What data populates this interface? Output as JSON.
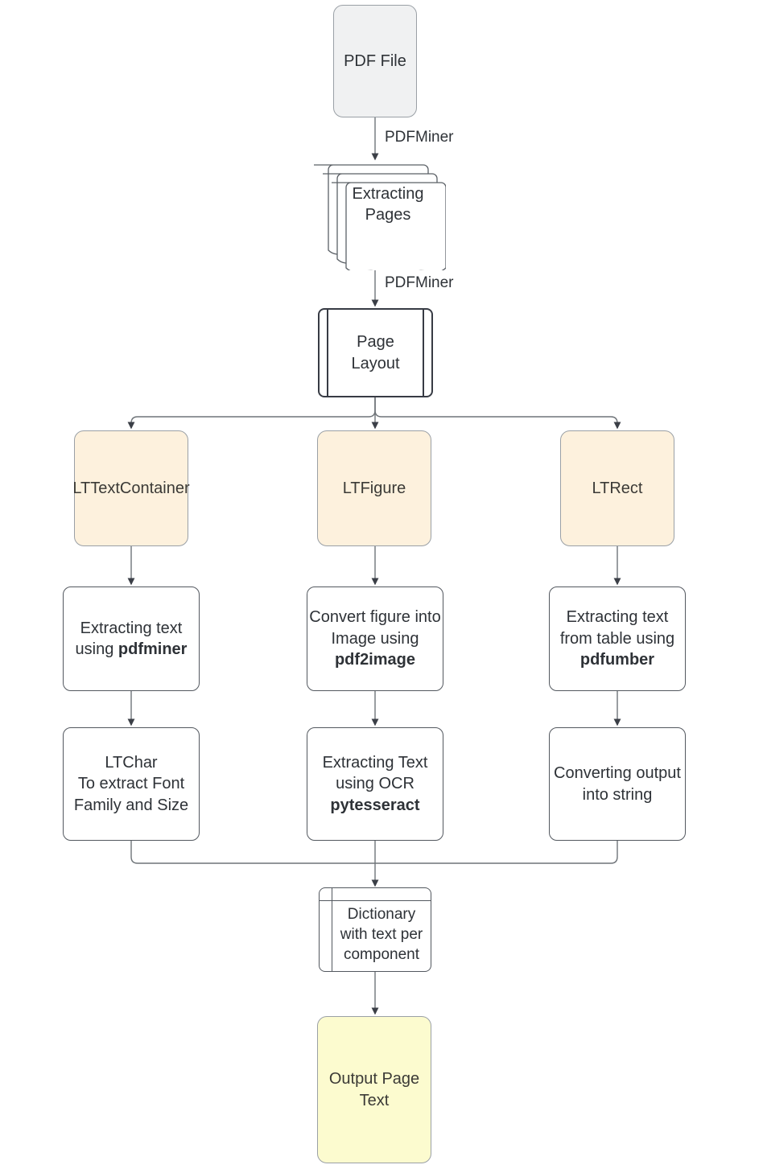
{
  "diagram": {
    "title": "PDF text extraction pipeline flowchart",
    "colors": {
      "cream_fill": "#fdf1dd",
      "yellow_fill": "#fcfbcf",
      "grey_fill": "#f0f1f2",
      "white_fill": "#ffffff",
      "dark_border": "#373b44",
      "grey_border": "#9aa0a6",
      "text": "#2e3237"
    }
  },
  "nodes": {
    "pdf_file": {
      "label": "PDF File",
      "shape": "rounded-rectangle"
    },
    "extracting_pages": {
      "label": "Extracting\nPages",
      "shape": "multi-document"
    },
    "page_layout": {
      "label": "Page\nLayout",
      "shape": "predefined-process"
    },
    "lttextcontainer": {
      "label": "LTTextContainer",
      "shape": "rounded-rectangle"
    },
    "ltfigure": {
      "label": "LTFigure",
      "shape": "rounded-rectangle"
    },
    "ltrect": {
      "label": "LTRect",
      "shape": "rounded-rectangle"
    },
    "extract_text_pdfminer": {
      "line1": "Extracting text",
      "line2_prefix": "using ",
      "line2_bold": "pdfminer"
    },
    "convert_figure": {
      "line1": "Convert figure into",
      "line2": "Image using",
      "line3_bold": "pdf2image"
    },
    "extract_table_pdfumber": {
      "line1": "Extracting text",
      "line2": "from table using",
      "line3_bold": "pdfumber"
    },
    "ltchar": {
      "label": "LTChar\nTo extract Font\nFamily and Size"
    },
    "ocr_pytesseract": {
      "line1": "Extracting Text",
      "line2": "using OCR",
      "line3_bold": "pytesseract"
    },
    "converting_output": {
      "label": "Converting output\ninto string"
    },
    "dictionary": {
      "label": "Dictionary\nwith text per\ncomponent",
      "shape": "internal-storage"
    },
    "output_page_text": {
      "label": "Output Page\nText",
      "shape": "rounded-rectangle"
    }
  },
  "edge_labels": {
    "pdf_to_pages": "PDFMiner",
    "pages_to_layout": "PDFMiner"
  }
}
